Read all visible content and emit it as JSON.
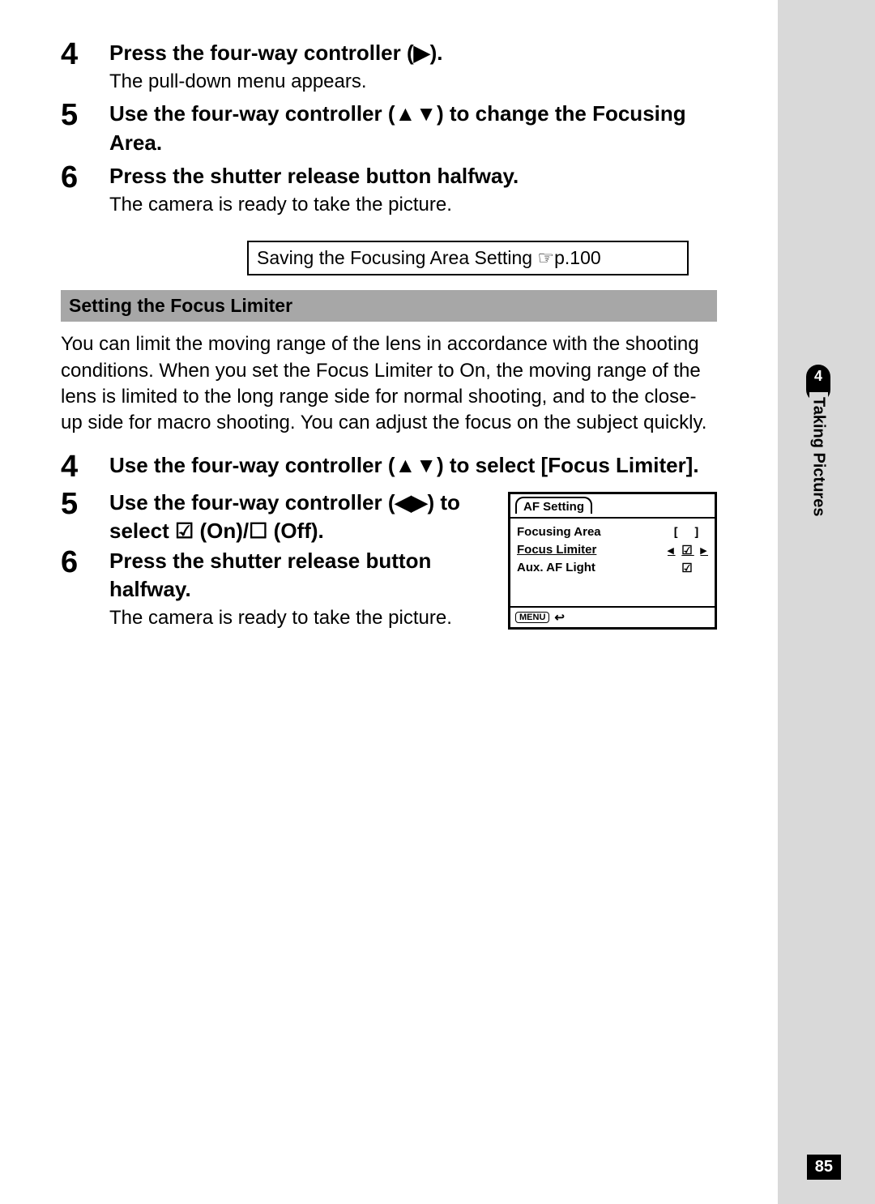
{
  "sidebar": {
    "chapter_number": "4",
    "chapter_label": "Taking Pictures"
  },
  "page_number": "85",
  "steps_a": [
    {
      "num": "4",
      "heading": "Press the four-way controller (▶).",
      "sub": "The pull-down menu appears."
    },
    {
      "num": "5",
      "heading": "Use the four-way controller (▲▼) to change the Focusing Area.",
      "sub": ""
    },
    {
      "num": "6",
      "heading": "Press the shutter release button halfway.",
      "sub": "The camera is ready to take the picture."
    }
  ],
  "save_box": "Saving the Focusing Area Setting ☞p.100",
  "section_heading": "Setting the Focus Limiter",
  "section_body": "You can limit the moving range of the lens in accordance with the shooting conditions. When you set the Focus Limiter to On, the moving range of the lens is limited to the long range side for normal shooting, and to the close-up side for macro shooting. You can adjust the focus on the subject quickly.",
  "steps_b": [
    {
      "num": "4",
      "heading": "Use the four-way controller (▲▼) to select [Focus Limiter].",
      "sub": ""
    },
    {
      "num": "5",
      "heading": "Use the four-way controller (◀▶) to select ☑ (On)/☐ (Off).",
      "sub": ""
    },
    {
      "num": "6",
      "heading": "Press the shutter release button halfway.",
      "sub": "The camera is ready to take the picture."
    }
  ],
  "menu": {
    "tab": "AF Setting",
    "items": [
      {
        "label": "Focusing Area",
        "icon": "[  ]",
        "selected": false
      },
      {
        "label": "Focus Limiter",
        "icon": "☑",
        "selected": true
      },
      {
        "label": "Aux. AF Light",
        "icon": "☑",
        "selected": false
      }
    ],
    "footer_button": "MENU",
    "footer_icon": "↩"
  }
}
